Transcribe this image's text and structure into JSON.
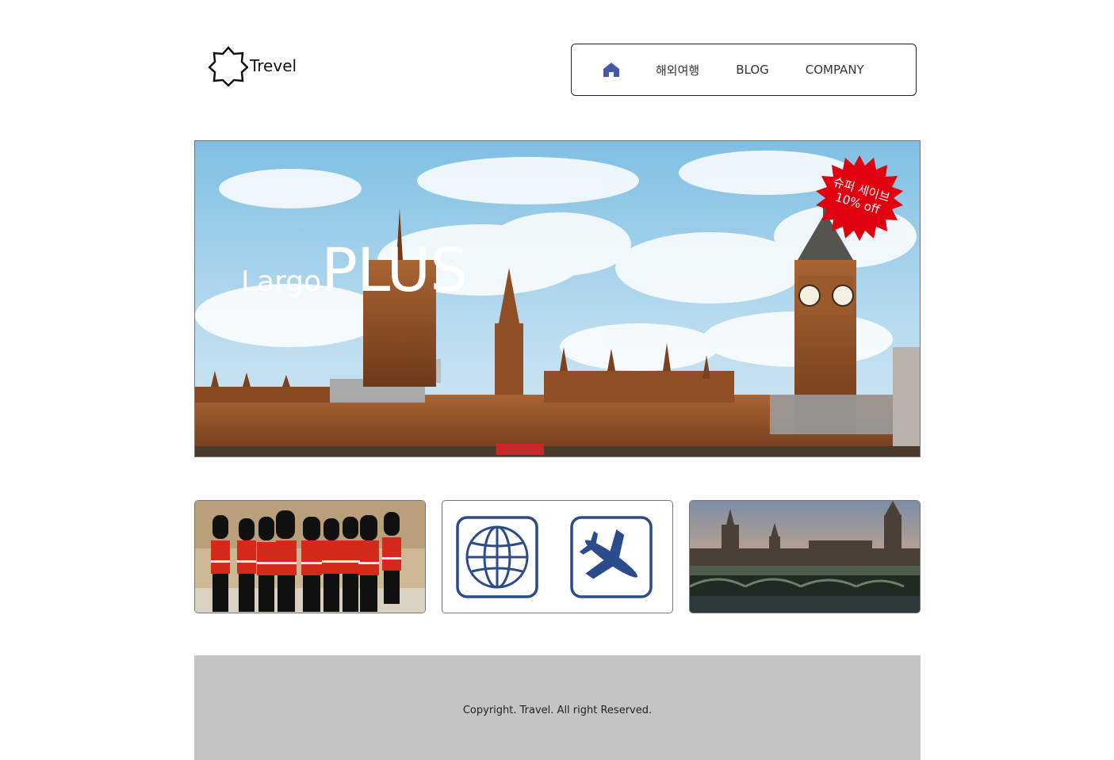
{
  "header": {
    "logo_text": "Trevel",
    "nav": {
      "home_icon": "home-icon",
      "items": [
        {
          "label": "해외여행"
        },
        {
          "label": "BLOG"
        },
        {
          "label": "COMPANY"
        }
      ]
    }
  },
  "hero": {
    "title_small": "Largo",
    "title_big": "PLUS",
    "badge_line1": "슈퍼 세이브",
    "badge_line2": "10% off",
    "badge_color": "#e0000f"
  },
  "cards": {
    "globe_icon": "globe-icon",
    "plane_icon": "airplane-icon",
    "icon_color": "#2b4c8c"
  },
  "footer": {
    "copyright": "Copyright. Travel. All right Reserved."
  }
}
